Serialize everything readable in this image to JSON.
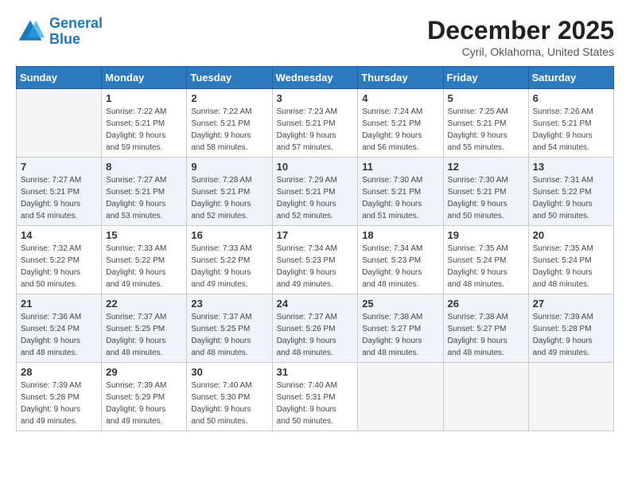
{
  "logo": {
    "line1": "General",
    "line2": "Blue"
  },
  "title": "December 2025",
  "subtitle": "Cyril, Oklahoma, United States",
  "weekdays": [
    "Sunday",
    "Monday",
    "Tuesday",
    "Wednesday",
    "Thursday",
    "Friday",
    "Saturday"
  ],
  "weeks": [
    [
      {
        "day": "",
        "info": ""
      },
      {
        "day": "1",
        "info": "Sunrise: 7:22 AM\nSunset: 5:21 PM\nDaylight: 9 hours\nand 59 minutes."
      },
      {
        "day": "2",
        "info": "Sunrise: 7:22 AM\nSunset: 5:21 PM\nDaylight: 9 hours\nand 58 minutes."
      },
      {
        "day": "3",
        "info": "Sunrise: 7:23 AM\nSunset: 5:21 PM\nDaylight: 9 hours\nand 57 minutes."
      },
      {
        "day": "4",
        "info": "Sunrise: 7:24 AM\nSunset: 5:21 PM\nDaylight: 9 hours\nand 56 minutes."
      },
      {
        "day": "5",
        "info": "Sunrise: 7:25 AM\nSunset: 5:21 PM\nDaylight: 9 hours\nand 55 minutes."
      },
      {
        "day": "6",
        "info": "Sunrise: 7:26 AM\nSunset: 5:21 PM\nDaylight: 9 hours\nand 54 minutes."
      }
    ],
    [
      {
        "day": "7",
        "info": "Sunrise: 7:27 AM\nSunset: 5:21 PM\nDaylight: 9 hours\nand 54 minutes."
      },
      {
        "day": "8",
        "info": "Sunrise: 7:27 AM\nSunset: 5:21 PM\nDaylight: 9 hours\nand 53 minutes."
      },
      {
        "day": "9",
        "info": "Sunrise: 7:28 AM\nSunset: 5:21 PM\nDaylight: 9 hours\nand 52 minutes."
      },
      {
        "day": "10",
        "info": "Sunrise: 7:29 AM\nSunset: 5:21 PM\nDaylight: 9 hours\nand 52 minutes."
      },
      {
        "day": "11",
        "info": "Sunrise: 7:30 AM\nSunset: 5:21 PM\nDaylight: 9 hours\nand 51 minutes."
      },
      {
        "day": "12",
        "info": "Sunrise: 7:30 AM\nSunset: 5:21 PM\nDaylight: 9 hours\nand 50 minutes."
      },
      {
        "day": "13",
        "info": "Sunrise: 7:31 AM\nSunset: 5:22 PM\nDaylight: 9 hours\nand 50 minutes."
      }
    ],
    [
      {
        "day": "14",
        "info": "Sunrise: 7:32 AM\nSunset: 5:22 PM\nDaylight: 9 hours\nand 50 minutes."
      },
      {
        "day": "15",
        "info": "Sunrise: 7:33 AM\nSunset: 5:22 PM\nDaylight: 9 hours\nand 49 minutes."
      },
      {
        "day": "16",
        "info": "Sunrise: 7:33 AM\nSunset: 5:22 PM\nDaylight: 9 hours\nand 49 minutes."
      },
      {
        "day": "17",
        "info": "Sunrise: 7:34 AM\nSunset: 5:23 PM\nDaylight: 9 hours\nand 49 minutes."
      },
      {
        "day": "18",
        "info": "Sunrise: 7:34 AM\nSunset: 5:23 PM\nDaylight: 9 hours\nand 48 minutes."
      },
      {
        "day": "19",
        "info": "Sunrise: 7:35 AM\nSunset: 5:24 PM\nDaylight: 9 hours\nand 48 minutes."
      },
      {
        "day": "20",
        "info": "Sunrise: 7:35 AM\nSunset: 5:24 PM\nDaylight: 9 hours\nand 48 minutes."
      }
    ],
    [
      {
        "day": "21",
        "info": "Sunrise: 7:36 AM\nSunset: 5:24 PM\nDaylight: 9 hours\nand 48 minutes."
      },
      {
        "day": "22",
        "info": "Sunrise: 7:37 AM\nSunset: 5:25 PM\nDaylight: 9 hours\nand 48 minutes."
      },
      {
        "day": "23",
        "info": "Sunrise: 7:37 AM\nSunset: 5:25 PM\nDaylight: 9 hours\nand 48 minutes."
      },
      {
        "day": "24",
        "info": "Sunrise: 7:37 AM\nSunset: 5:26 PM\nDaylight: 9 hours\nand 48 minutes."
      },
      {
        "day": "25",
        "info": "Sunrise: 7:38 AM\nSunset: 5:27 PM\nDaylight: 9 hours\nand 48 minutes."
      },
      {
        "day": "26",
        "info": "Sunrise: 7:38 AM\nSunset: 5:27 PM\nDaylight: 9 hours\nand 48 minutes."
      },
      {
        "day": "27",
        "info": "Sunrise: 7:39 AM\nSunset: 5:28 PM\nDaylight: 9 hours\nand 49 minutes."
      }
    ],
    [
      {
        "day": "28",
        "info": "Sunrise: 7:39 AM\nSunset: 5:28 PM\nDaylight: 9 hours\nand 49 minutes."
      },
      {
        "day": "29",
        "info": "Sunrise: 7:39 AM\nSunset: 5:29 PM\nDaylight: 9 hours\nand 49 minutes."
      },
      {
        "day": "30",
        "info": "Sunrise: 7:40 AM\nSunset: 5:30 PM\nDaylight: 9 hours\nand 50 minutes."
      },
      {
        "day": "31",
        "info": "Sunrise: 7:40 AM\nSunset: 5:31 PM\nDaylight: 9 hours\nand 50 minutes."
      },
      {
        "day": "",
        "info": ""
      },
      {
        "day": "",
        "info": ""
      },
      {
        "day": "",
        "info": ""
      }
    ]
  ]
}
